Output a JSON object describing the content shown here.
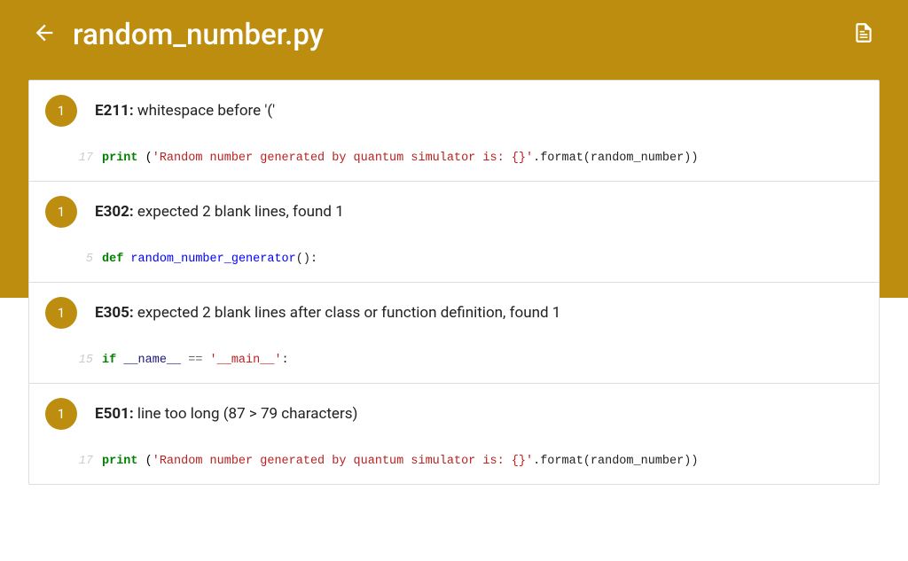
{
  "header": {
    "title": "random_number.py"
  },
  "issues": [
    {
      "count": "1",
      "code": "E211:",
      "message": " whitespace before '('",
      "line_num": "17",
      "preview_kind": "print"
    },
    {
      "count": "1",
      "code": "E302:",
      "message": " expected 2 blank lines, found 1",
      "line_num": "5",
      "preview_kind": "def"
    },
    {
      "count": "1",
      "code": "E305:",
      "message": " expected 2 blank lines after class or function definition, found 1",
      "line_num": "15",
      "preview_kind": "ifmain"
    },
    {
      "count": "1",
      "code": "E501:",
      "message": " line too long (87 > 79 characters)",
      "line_num": "17",
      "preview_kind": "print"
    }
  ],
  "code_tokens": {
    "print": {
      "kw": "print",
      "sp": " (",
      "str": "'Random number generated by quantum simulator is: {}'",
      "rest": ".format(random_number))"
    },
    "def": {
      "kw": "def",
      "sp": " ",
      "fn": "random_number_generator",
      "rest": "():"
    },
    "ifmain": {
      "kw": "if",
      "sp": " ",
      "name": "__name__",
      "eq": " == ",
      "str": "'__main__'",
      "rest": ":"
    }
  }
}
